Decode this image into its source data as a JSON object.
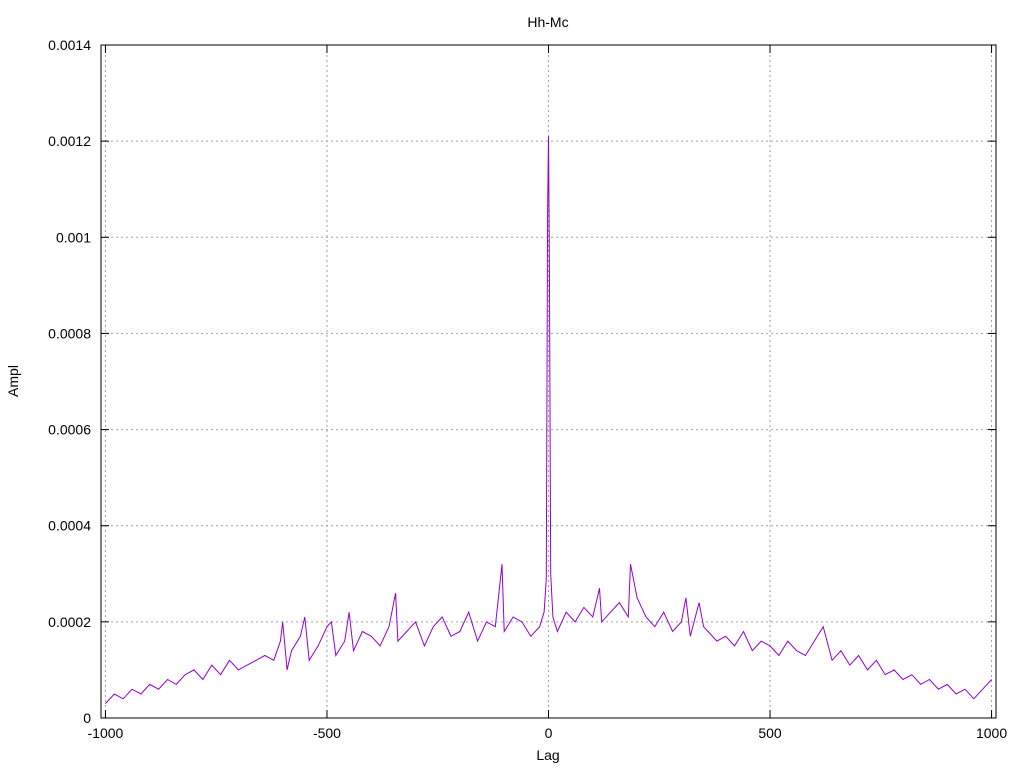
{
  "chart_data": {
    "type": "line",
    "title": "Hh-Mc",
    "xlabel": "Lag",
    "ylabel": "Ampl",
    "xlim": [
      -1010,
      1010
    ],
    "ylim": [
      0,
      0.0014
    ],
    "x_ticks": [
      -1000,
      -500,
      0,
      500,
      1000
    ],
    "x_tick_labels": [
      "-1000",
      "-500",
      "0",
      "500",
      "1000"
    ],
    "y_ticks": [
      0,
      0.0002,
      0.0004,
      0.0006,
      0.0008,
      0.001,
      0.0012,
      0.0014
    ],
    "y_tick_labels": [
      "0",
      "0.0002",
      "0.0004",
      "0.0006",
      "0.0008",
      "0.001",
      "0.0012",
      "0.0014"
    ],
    "grid": true,
    "series": [
      {
        "color": "#9400d3",
        "x": [
          -1000,
          -980,
          -960,
          -940,
          -920,
          -900,
          -880,
          -860,
          -840,
          -820,
          -800,
          -780,
          -760,
          -740,
          -720,
          -700,
          -680,
          -660,
          -640,
          -620,
          -605,
          -600,
          -590,
          -580,
          -560,
          -550,
          -540,
          -520,
          -500,
          -490,
          -480,
          -460,
          -450,
          -440,
          -420,
          -400,
          -380,
          -360,
          -345,
          -340,
          -320,
          -300,
          -280,
          -260,
          -240,
          -220,
          -200,
          -180,
          -160,
          -140,
          -120,
          -105,
          -100,
          -80,
          -60,
          -40,
          -20,
          -10,
          -5,
          -2,
          0,
          2,
          5,
          10,
          20,
          40,
          60,
          80,
          100,
          115,
          120,
          140,
          160,
          180,
          185,
          200,
          220,
          240,
          260,
          280,
          300,
          310,
          320,
          340,
          350,
          360,
          380,
          400,
          420,
          440,
          460,
          480,
          500,
          520,
          540,
          560,
          580,
          600,
          620,
          640,
          660,
          680,
          700,
          720,
          740,
          760,
          780,
          800,
          820,
          840,
          860,
          880,
          900,
          920,
          940,
          960,
          980,
          1000
        ],
        "y": [
          3e-05,
          5e-05,
          4e-05,
          6e-05,
          5e-05,
          7e-05,
          6e-05,
          8e-05,
          7e-05,
          9e-05,
          0.0001,
          8e-05,
          0.00011,
          9e-05,
          0.00012,
          0.0001,
          0.00011,
          0.00012,
          0.00013,
          0.00012,
          0.00016,
          0.0002,
          0.0001,
          0.00014,
          0.00017,
          0.00021,
          0.00012,
          0.00015,
          0.00019,
          0.0002,
          0.00013,
          0.00016,
          0.00022,
          0.00014,
          0.00018,
          0.00017,
          0.00015,
          0.00019,
          0.00026,
          0.00016,
          0.00018,
          0.0002,
          0.00015,
          0.00019,
          0.00021,
          0.00017,
          0.00018,
          0.00022,
          0.00016,
          0.0002,
          0.00019,
          0.00032,
          0.00018,
          0.00021,
          0.0002,
          0.00017,
          0.00019,
          0.00022,
          0.00029,
          0.00105,
          0.00121,
          0.00095,
          0.0003,
          0.00021,
          0.00018,
          0.00022,
          0.0002,
          0.00023,
          0.00021,
          0.00027,
          0.0002,
          0.00022,
          0.00024,
          0.00021,
          0.00032,
          0.00025,
          0.00021,
          0.00019,
          0.00022,
          0.00018,
          0.0002,
          0.00025,
          0.00017,
          0.00024,
          0.00019,
          0.00018,
          0.00016,
          0.00017,
          0.00015,
          0.00018,
          0.00014,
          0.00016,
          0.00015,
          0.00013,
          0.00016,
          0.00014,
          0.00013,
          0.00016,
          0.00019,
          0.00012,
          0.00014,
          0.00011,
          0.00013,
          0.0001,
          0.00012,
          9e-05,
          0.0001,
          8e-05,
          9e-05,
          7e-05,
          8e-05,
          6e-05,
          7e-05,
          5e-05,
          6e-05,
          4e-05,
          6e-05,
          8e-05
        ]
      }
    ]
  }
}
